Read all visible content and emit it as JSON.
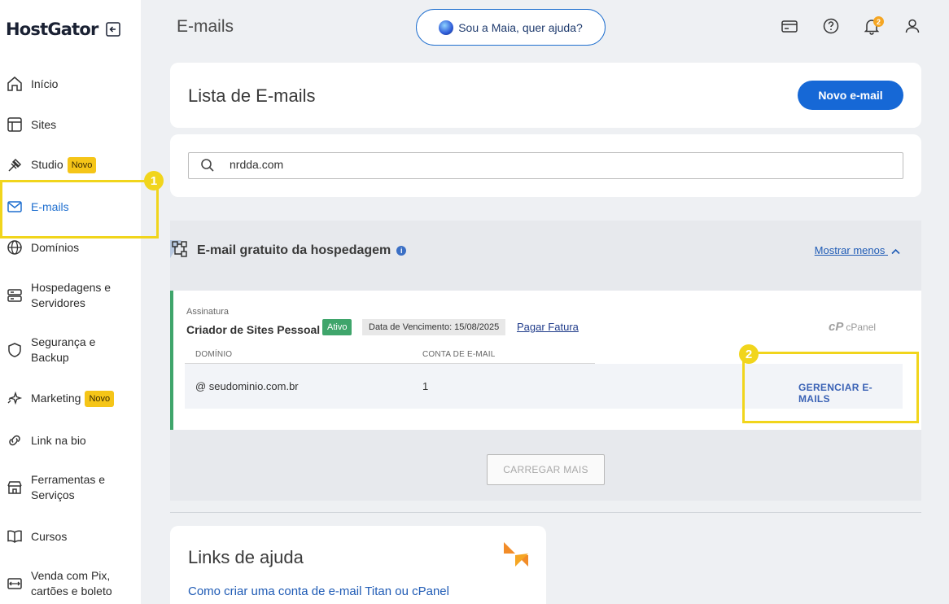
{
  "brand": {
    "name": "HostGator"
  },
  "sidebar": {
    "items": [
      {
        "label": "Início",
        "icon": "home-icon"
      },
      {
        "label": "Sites",
        "icon": "layout-icon"
      },
      {
        "label": "Studio",
        "icon": "studio-icon",
        "badge": "Novo"
      },
      {
        "label": "E-mails",
        "icon": "mail-icon",
        "active": true
      },
      {
        "label": "Domínios",
        "icon": "globe-icon"
      },
      {
        "label": "Hospedagens e Servidores",
        "icon": "server-icon"
      },
      {
        "label": "Segurança e Backup",
        "icon": "shield-icon"
      },
      {
        "label": "Marketing",
        "icon": "sparkle-icon",
        "badge": "Novo"
      },
      {
        "label": "Link na bio",
        "icon": "link-icon"
      },
      {
        "label": "Ferramentas e Serviços",
        "icon": "tools-icon"
      },
      {
        "label": "Cursos",
        "icon": "book-icon"
      },
      {
        "label": "Venda com Pix, cartões e boleto",
        "icon": "payment-icon"
      }
    ]
  },
  "annotations": {
    "step1": "1",
    "step2": "2",
    "color": "#f1d51c"
  },
  "header": {
    "title": "E-mails",
    "assistant_label": "Sou a Maia, quer ajuda?",
    "notification_count": "2"
  },
  "email_list": {
    "title": "Lista de E-mails",
    "new_button": "Novo e-mail"
  },
  "search": {
    "value": "nrdda.com"
  },
  "hosting_panel": {
    "title": "E-mail gratuito da hospedagem",
    "toggle_label": "Mostrar menos",
    "subscription": {
      "label": "Assinatura",
      "plan": "Criador de Sites Pessoal",
      "status": "Ativo",
      "due_date": "Data de Vencimento: 15/08/2025",
      "pay_link": "Pagar Fatura",
      "provider": "cPanel"
    },
    "table": {
      "columns": [
        "DOMÍNIO",
        "CONTA DE E-MAIL"
      ],
      "rows": [
        {
          "domain": "@ seudominio.com.br",
          "accounts": "1",
          "action": "GERENCIAR E-MAILS"
        }
      ]
    },
    "load_more": "CARREGAR MAIS"
  },
  "help": {
    "title": "Links de ajuda",
    "links": [
      "Como criar uma conta de e-mail Titan ou cPanel"
    ]
  },
  "colors": {
    "primary": "#1668d6",
    "active_green": "#3fa56b",
    "badge_yellow": "#f5c518"
  }
}
